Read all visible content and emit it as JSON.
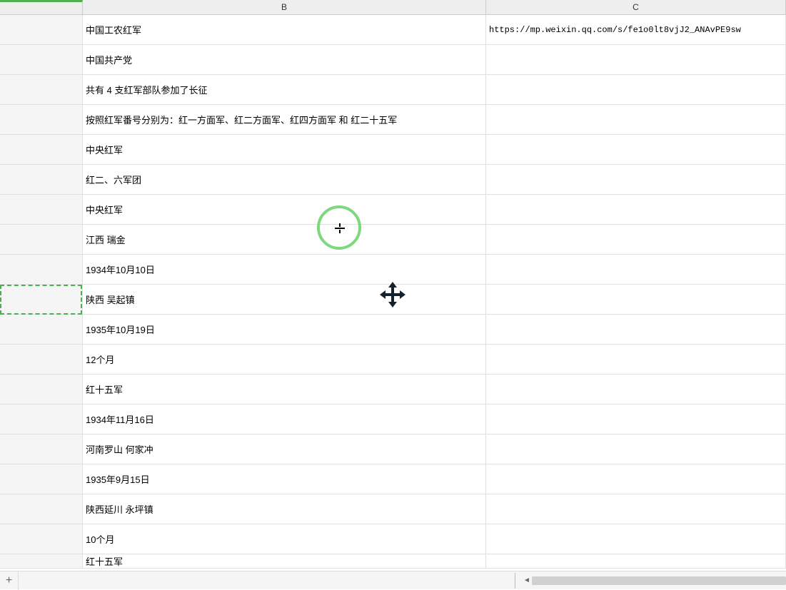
{
  "columns": {
    "b_label": "B",
    "c_label": "C"
  },
  "rows": [
    {
      "b": "中国工农红军",
      "c": "https://mp.weixin.qq.com/s/fe1o0lt8vjJ2_ANAvPE9sw"
    },
    {
      "b": "中国共产党",
      "c": ""
    },
    {
      "b": "共有 4 支红军部队参加了长征",
      "c": ""
    },
    {
      "b": "按照红军番号分别为：红一方面军、红二方面军、红四方面军 和 红二十五军",
      "c": ""
    },
    {
      "b": "中央红军",
      "c": ""
    },
    {
      "b": "红二、六军团",
      "c": ""
    },
    {
      "b": "中央红军",
      "c": ""
    },
    {
      "b": "江西 瑞金",
      "c": ""
    },
    {
      "b": "1934年10月10日",
      "c": ""
    },
    {
      "b": "陕西 吴起镇",
      "c": ""
    },
    {
      "b": "1935年10月19日",
      "c": ""
    },
    {
      "b": "12个月",
      "c": ""
    },
    {
      "b": "红十五军",
      "c": ""
    },
    {
      "b": "1934年11月16日",
      "c": ""
    },
    {
      "b": "河南罗山 何家冲",
      "c": ""
    },
    {
      "b": "1935年9月15日",
      "c": ""
    },
    {
      "b": "陕西延川 永坪镇",
      "c": ""
    },
    {
      "b": "10个月",
      "c": ""
    },
    {
      "b": "红十五军",
      "c": ""
    }
  ],
  "footer": {
    "add_label": "+"
  }
}
